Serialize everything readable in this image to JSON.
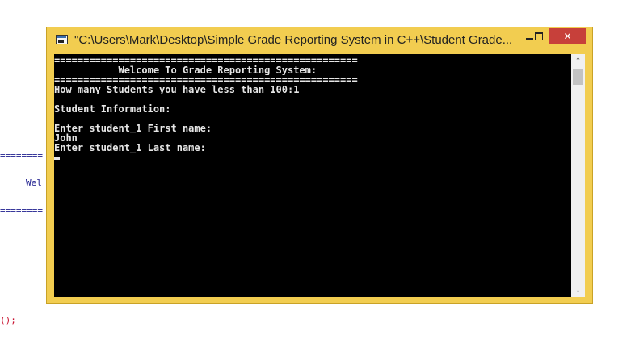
{
  "background_editor": {
    "equals_line_1": "========",
    "welcome_fragment": "Wel",
    "equals_line_2": "========",
    "paren_fragment": "();"
  },
  "window": {
    "title": "\"C:\\Users\\Mark\\Desktop\\Simple Grade Reporting System in C++\\Student Grade...",
    "minimize_label": "",
    "maximize_label": "",
    "close_label": "✕"
  },
  "console": {
    "lines": [
      "====================================================",
      "           Welcome To Grade Reporting System:",
      "====================================================",
      "How many Students you have less than 100:1",
      "",
      "Student Information:",
      "",
      "Enter student_1 First name:",
      "John",
      "Enter student_1 Last name:"
    ]
  },
  "scrollbar": {
    "up_arrow": "⌃",
    "down_arrow": "⌄"
  },
  "colors": {
    "window_frame": "#f2cd50",
    "close_button": "#c7403a",
    "console_background": "#000000",
    "console_text": "#e6e6e6"
  }
}
